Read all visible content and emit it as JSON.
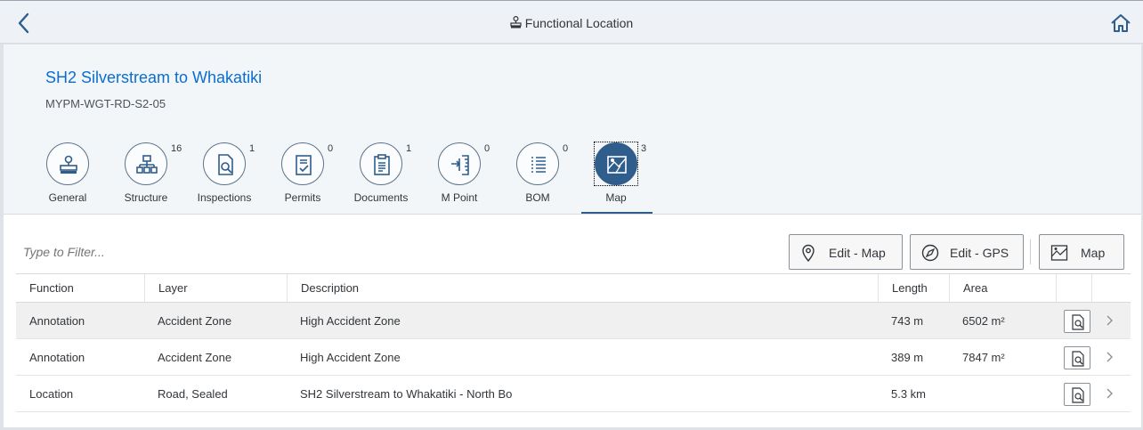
{
  "shell": {
    "title": "Functional Location",
    "back_icon": "chevron-left-icon",
    "home_icon": "home-icon"
  },
  "object": {
    "title": "SH2 Silverstream to Whakatiki",
    "subtitle": "MYPM-WGT-RD-S2-05"
  },
  "tabs": [
    {
      "label": "General",
      "count": "",
      "icon": "location-card-icon"
    },
    {
      "label": "Structure",
      "count": "16",
      "icon": "hierarchy-icon"
    },
    {
      "label": "Inspections",
      "count": "1",
      "icon": "inspect-document-icon"
    },
    {
      "label": "Permits",
      "count": "0",
      "icon": "permit-document-icon"
    },
    {
      "label": "Documents",
      "count": "1",
      "icon": "clipboard-icon"
    },
    {
      "label": "M Point",
      "count": "0",
      "icon": "measuring-point-icon"
    },
    {
      "label": "BOM",
      "count": "0",
      "icon": "list-icon"
    },
    {
      "label": "Map",
      "count": "3",
      "icon": "map-icon",
      "selected": true
    }
  ],
  "toolbar": {
    "filter_placeholder": "Type to Filter...",
    "edit_map_label": "Edit - Map",
    "edit_gps_label": "Edit - GPS",
    "map_label": "Map"
  },
  "table": {
    "columns": [
      "Function",
      "Layer",
      "Description",
      "Length",
      "Area"
    ],
    "rows": [
      {
        "function": "Annotation",
        "layer": "Accident Zone",
        "description": "High Accident Zone",
        "length": "743 m",
        "area": "6502 m²"
      },
      {
        "function": "Annotation",
        "layer": "Accident Zone",
        "description": "High Accident Zone",
        "length": "389 m",
        "area": "7847 m²"
      },
      {
        "function": "Location",
        "layer": "Road, Sealed",
        "description": "SH2 Silverstream to Whakatiki - North Bo",
        "length": "5.3 km",
        "area": ""
      }
    ]
  },
  "colors": {
    "accent": "#0a6ed1",
    "selected_tab": "#2f5d8c"
  }
}
